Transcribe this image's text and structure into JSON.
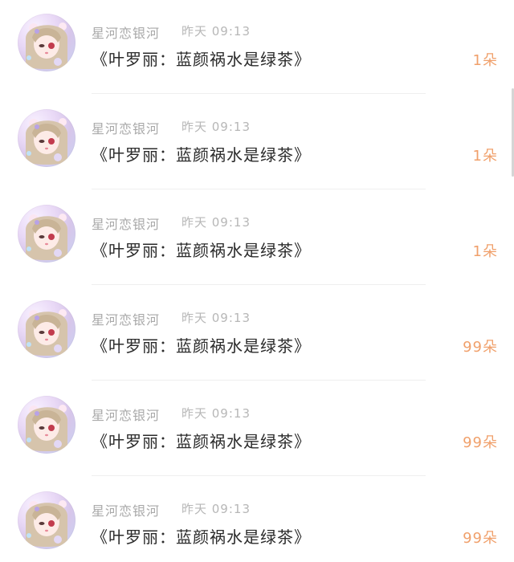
{
  "items": [
    {
      "user": "星河恋银河",
      "time": "昨天 09:13",
      "message": "《叶罗丽：蓝颜祸水是绿茶》",
      "count": "1朵"
    },
    {
      "user": "星河恋银河",
      "time": "昨天 09:13",
      "message": "《叶罗丽：蓝颜祸水是绿茶》",
      "count": "1朵"
    },
    {
      "user": "星河恋银河",
      "time": "昨天 09:13",
      "message": "《叶罗丽：蓝颜祸水是绿茶》",
      "count": "1朵"
    },
    {
      "user": "星河恋银河",
      "time": "昨天 09:13",
      "message": "《叶罗丽：蓝颜祸水是绿茶》",
      "count": "99朵"
    },
    {
      "user": "星河恋银河",
      "time": "昨天 09:13",
      "message": "《叶罗丽：蓝颜祸水是绿茶》",
      "count": "99朵"
    },
    {
      "user": "星河恋银河",
      "time": "昨天 09:13",
      "message": "《叶罗丽：蓝颜祸水是绿茶》",
      "count": "99朵"
    }
  ],
  "colors": {
    "count": "#f0a06b",
    "username": "#a9a9a9",
    "time": "#b7b7b7",
    "message": "#2b2b2b",
    "divider": "#efefef"
  },
  "icons": {
    "avatar": "anime-girl-avatar"
  }
}
